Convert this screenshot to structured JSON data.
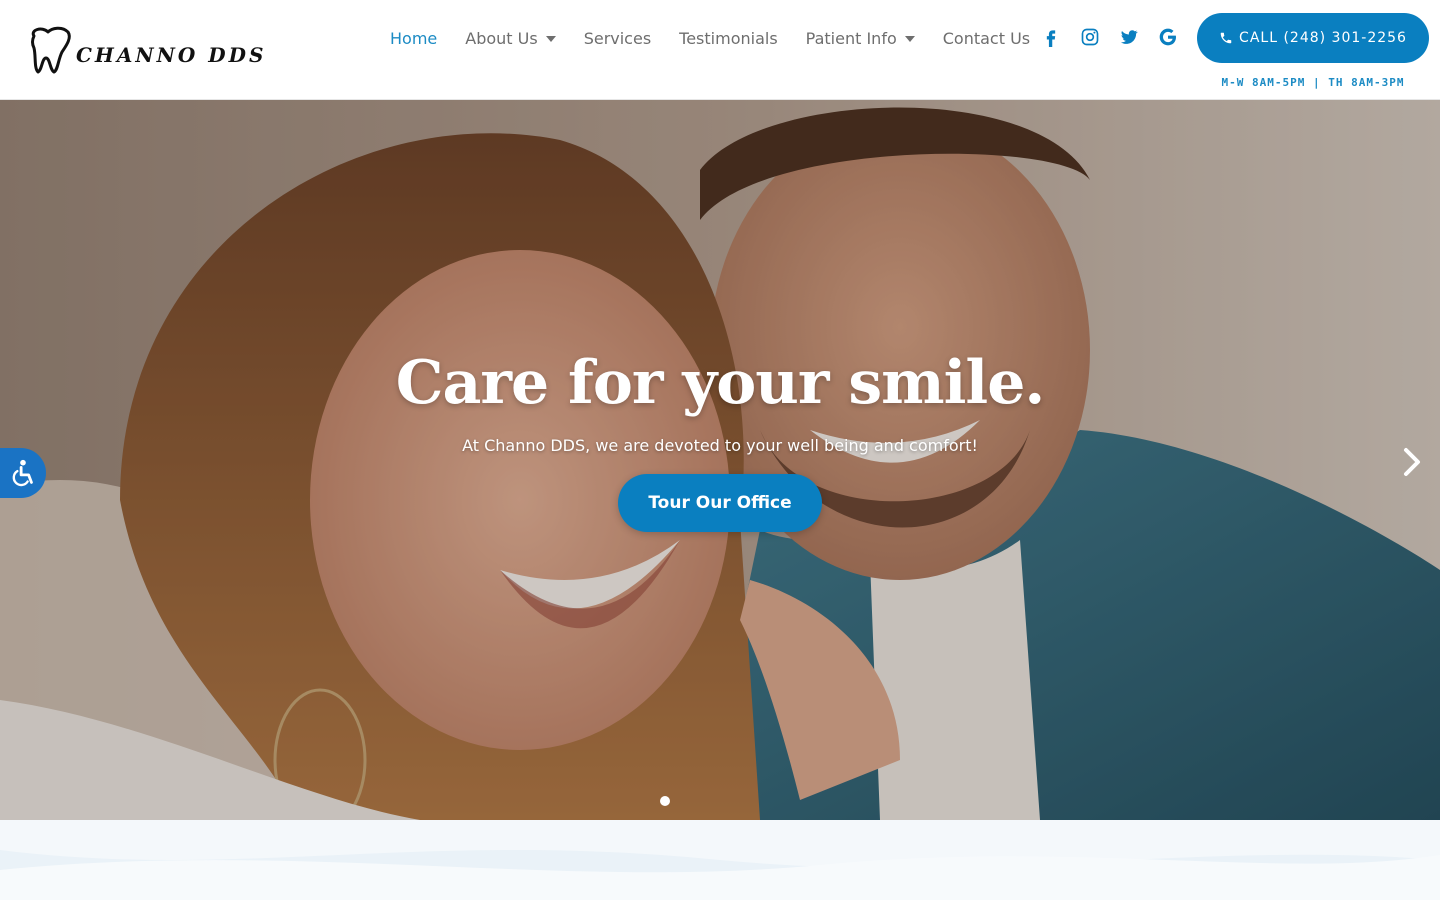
{
  "brand": {
    "logo_text": "CHANNO DDS",
    "accent_color": "#0a7fc0",
    "link_color": "#1c8bc4"
  },
  "nav": {
    "items": [
      {
        "label": "Home",
        "active": true,
        "dropdown": false
      },
      {
        "label": "About Us",
        "active": false,
        "dropdown": true
      },
      {
        "label": "Services",
        "active": false,
        "dropdown": false
      },
      {
        "label": "Testimonials",
        "active": false,
        "dropdown": false
      },
      {
        "label": "Patient Info",
        "active": false,
        "dropdown": true
      },
      {
        "label": "Contact Us",
        "active": false,
        "dropdown": false
      }
    ]
  },
  "social": {
    "icons": [
      "facebook-icon",
      "instagram-icon",
      "twitter-icon",
      "google-icon"
    ]
  },
  "contact": {
    "call_label": "CALL (248) 301-2256",
    "hours": "M-W 8AM-5PM | TH 8AM-3PM"
  },
  "hero": {
    "title": "Care for your smile.",
    "subtitle": "At Channo DDS, we are devoted to your well being and comfort!",
    "cta_label": "Tour Our Office",
    "slide_count": 1,
    "active_slide": 1
  },
  "accessibility": {
    "icon": "accessibility-icon"
  }
}
